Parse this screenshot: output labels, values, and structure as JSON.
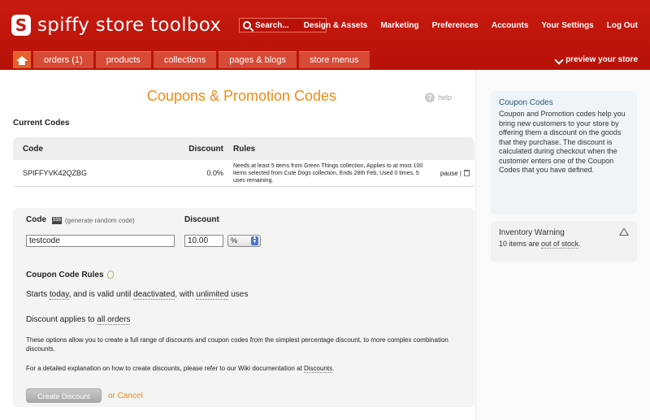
{
  "header": {
    "brand": "spiffy store toolbox",
    "logo_letter": "S",
    "search_placeholder": "Search...",
    "nav": [
      "Design & Assets",
      "Marketing",
      "Preferences",
      "Accounts",
      "Your Settings",
      "Log Out"
    ],
    "tabs": [
      "orders (1)",
      "products",
      "collections",
      "pages & blogs",
      "store menus"
    ],
    "preview": "preview your store"
  },
  "page": {
    "title": "Coupons & Promotion Codes",
    "help": "help",
    "current_codes_label": "Current Codes"
  },
  "codes_table": {
    "headers": [
      "Code",
      "Discount",
      "Rules"
    ],
    "rows": [
      {
        "code": "SPIFFYVK42QZBG",
        "discount": "0.0%",
        "rules": "Needs at least 5 items from Green Things collection, Applies to at most 100 items selected from Cute Dogs collection, Ends 28th Feb, Used 0 times, 5 uses remaining.",
        "action": "pause |"
      }
    ]
  },
  "form": {
    "code_label": "Code",
    "generate_text": "(generate random code)",
    "discount_label": "Discount",
    "code_value": "testcode",
    "discount_value": "10.00",
    "unit_value": "%",
    "rules_title": "Coupon Code Rules",
    "rules_starts": "Starts ",
    "rules_today": "today",
    "rules_valid": ", and is valid until ",
    "rules_deactivated": "deactivated",
    "rules_with": ", with ",
    "rules_unlimited": "unlimited",
    "rules_uses": " uses",
    "applies_prefix": "Discount applies to ",
    "applies_link": "all orders",
    "description1": "These options allow you to create a full range of discounts and coupon codes from the simplest percentage discount, to more complex combination discounts.",
    "description2_prefix": "For a detailed explanation on how to create discounts, please refer to our Wiki documentation at ",
    "description2_link": "Discounts",
    "description2_suffix": ".",
    "create_button": "Create Discount",
    "or_cancel": "or Cancel"
  },
  "sidebar": {
    "info_title": "Coupon Codes",
    "info_text": "Coupon and Promotion codes help you bring new customers to your store by offering them a discount on the goods that they purchase. The discount is calculated during checkout when the customer enters one of the Coupon Codes that you have defined.",
    "warning_title": "Inventory Warning",
    "warning_prefix": "10 items are ",
    "warning_link": "out of stock",
    "warning_suffix": "."
  }
}
